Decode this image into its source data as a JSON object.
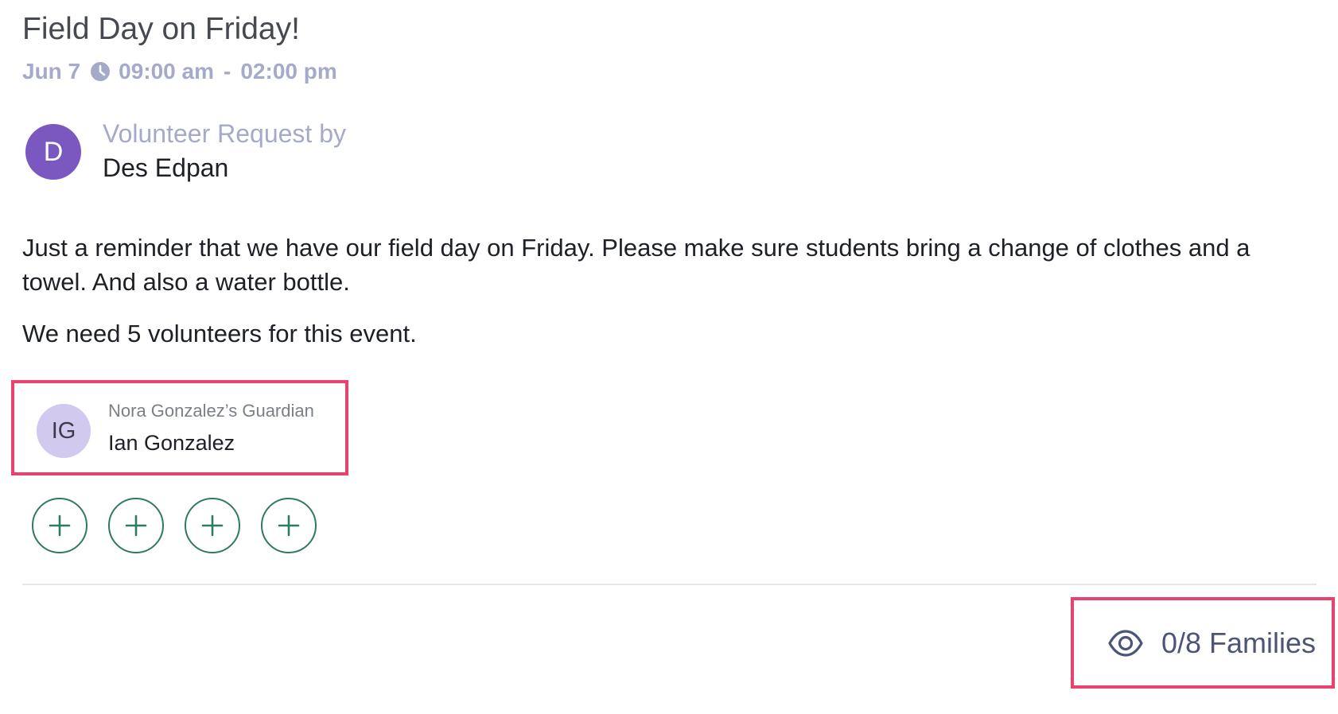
{
  "event": {
    "title": "Field Day on Friday!",
    "date": "Jun 7",
    "start_time": "09:00 am",
    "separator": "-",
    "end_time": "02:00 pm",
    "clock_icon": "clock-icon"
  },
  "author": {
    "avatar_initial": "D",
    "avatar_color": "#7b57c0",
    "caption": "Volunteer Request by",
    "name": "Des Edpan"
  },
  "description": {
    "paragraph_1": "Just a reminder that we have our field day on Friday. Please make sure students bring a change of clothes and a towel. And also a water bottle.",
    "paragraph_2": "We need 5 volunteers for this event."
  },
  "volunteers": [
    {
      "initials": "IG",
      "role": "Nora Gonzalez’s Guardian",
      "name": "Ian Gonzalez",
      "avatar_color": "#d2c9ee"
    }
  ],
  "open_slots": {
    "count": 4,
    "icon": "plus-icon",
    "color": "#2e7a62"
  },
  "footer": {
    "families_seen": "0/8 Families",
    "icon": "eye-icon"
  },
  "highlight_color": "#e8436f"
}
